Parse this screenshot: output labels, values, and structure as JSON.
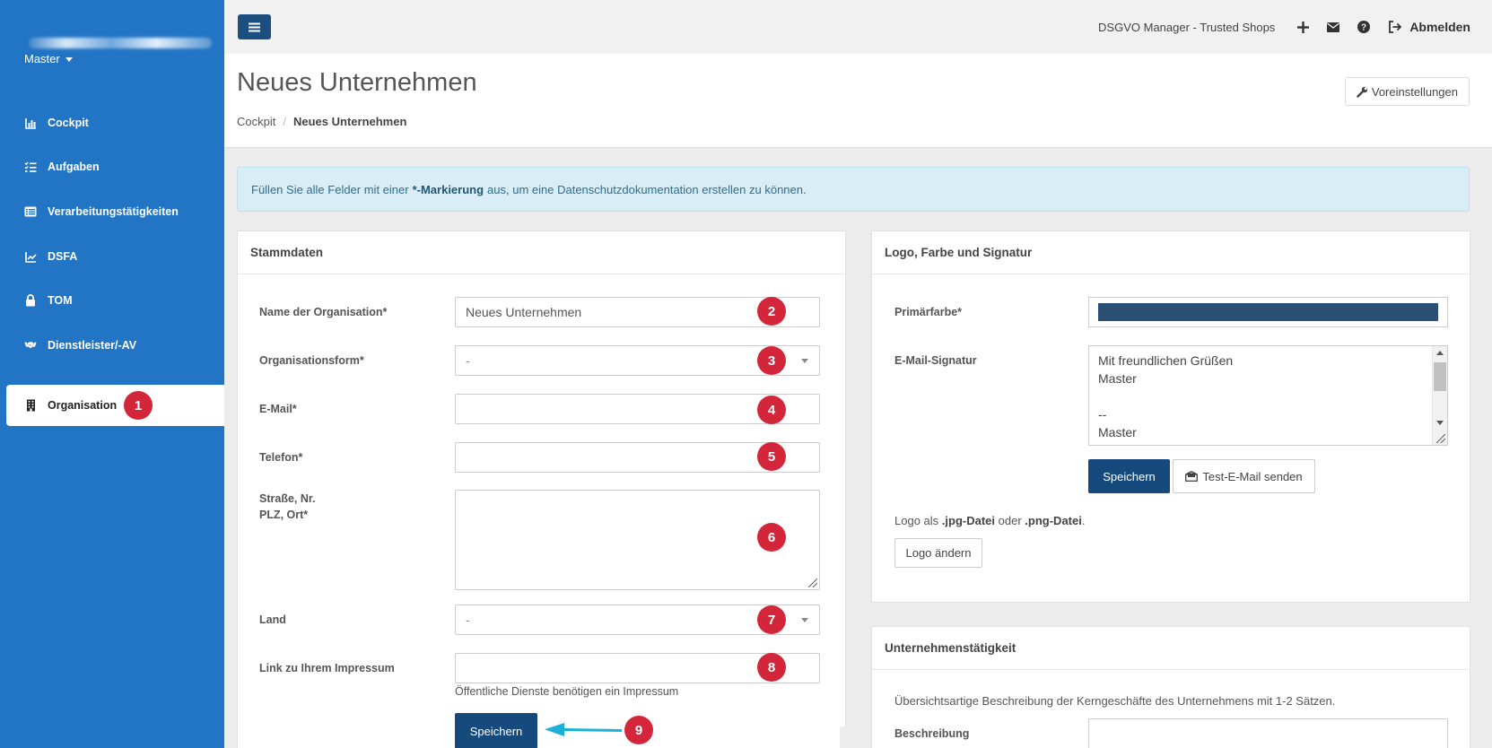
{
  "sidebar": {
    "user_menu": "Master",
    "items": [
      {
        "label": "Cockpit",
        "icon": "bar-chart-icon"
      },
      {
        "label": "Aufgaben",
        "icon": "tasks-icon"
      },
      {
        "label": "Verarbeitungstätigkeiten",
        "icon": "list-icon"
      },
      {
        "label": "DSFA",
        "icon": "line-chart-icon"
      },
      {
        "label": "TOM",
        "icon": "lock-icon"
      },
      {
        "label": "Dienstleister/-AV",
        "icon": "handshake-icon"
      },
      {
        "label": "Organisation",
        "icon": "building-icon",
        "active": true
      }
    ]
  },
  "topbar": {
    "app_name": "DSGVO Manager - Trusted Shops",
    "logout_label": "Abmelden"
  },
  "header": {
    "title": "Neues Unternehmen",
    "breadcrumb": [
      "Cockpit",
      "Neues Unternehmen"
    ],
    "preset_button": "Voreinstellungen"
  },
  "alert": {
    "before": "Füllen Sie alle Felder mit einer",
    "bold": "*-Markierung",
    "after": "aus, um eine Datenschutzdokumentation erstellen zu können."
  },
  "stammdaten": {
    "title": "Stammdaten",
    "name_label": "Name der Organisation*",
    "name_value": "Neues Unternehmen",
    "form_label": "Organisationsform*",
    "form_value": "-",
    "email_label": "E-Mail*",
    "email_value": "",
    "phone_label": "Telefon*",
    "phone_value": "",
    "address_label_1": "Straße, Nr.",
    "address_label_2": "PLZ, Ort*",
    "address_value": "",
    "country_label": "Land",
    "country_value": "-",
    "imprint_label": "Link zu Ihrem Impressum",
    "imprint_value": "",
    "imprint_hint": "Öffentliche Dienste benötigen ein Impressum",
    "save_button": "Speichern"
  },
  "logo_panel": {
    "title": "Logo, Farbe und Signatur",
    "color_label": "Primärfarbe*",
    "primary_color": "#2b4e74",
    "signature_label": "E-Mail-Signatur",
    "signature_lines": [
      "Mit freundlichen Grüßen",
      "Master",
      "",
      "--",
      "Master"
    ],
    "save_button": "Speichern",
    "test_mail_button": "Test-E-Mail senden",
    "logo_note_1": "Logo als",
    "logo_note_jpg": ".jpg-Datei",
    "logo_note_or": "oder",
    "logo_note_png": ".png-Datei",
    "logo_note_end": ".",
    "change_logo_button": "Logo ändern"
  },
  "activity_panel": {
    "title": "Unternehmenstätigkeit",
    "description": "Übersichtsartige Beschreibung der Kerngeschäfte des Unternehmens mit 1-2 Sätzen.",
    "beschreibung_label": "Beschreibung"
  },
  "annotations": [
    "1",
    "2",
    "3",
    "4",
    "5",
    "6",
    "7",
    "8",
    "9"
  ],
  "colors": {
    "sidebar": "#2274c4",
    "primary_button": "#174a7c",
    "badge": "#d3263a",
    "arrow": "#1cb0d8"
  }
}
